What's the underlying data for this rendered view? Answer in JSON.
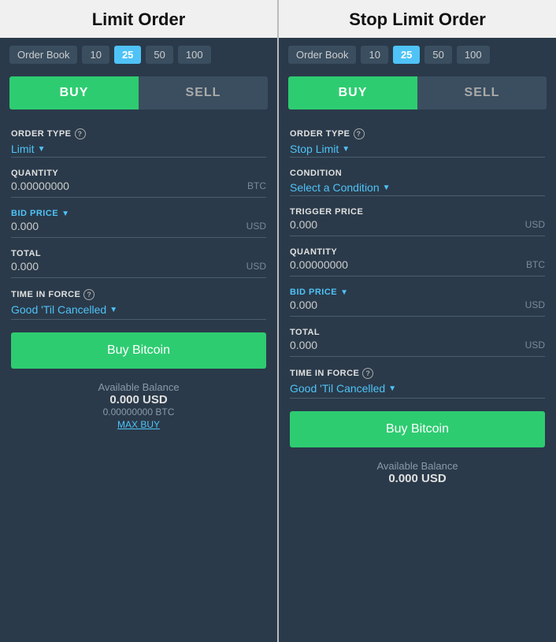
{
  "left_panel": {
    "title": "Limit Order",
    "order_book": {
      "label": "Order Book",
      "options": [
        "10",
        "25",
        "50",
        "100"
      ],
      "active": "25"
    },
    "buy_label": "BUY",
    "sell_label": "SELL",
    "order_type_label": "ORDER TYPE",
    "order_type_value": "Limit",
    "quantity_label": "QUANTITY",
    "quantity_value": "0.00000000",
    "quantity_unit": "BTC",
    "bid_price_label": "BID PRICE",
    "bid_price_value": "0.000",
    "bid_price_unit": "USD",
    "total_label": "TOTAL",
    "total_value": "0.000",
    "total_unit": "USD",
    "time_in_force_label": "TIME IN FORCE",
    "time_in_force_value": "Good 'Til Cancelled",
    "buy_button_label": "Buy Bitcoin",
    "available_balance_label": "Available Balance",
    "usd_amount": "0.000  USD",
    "btc_amount": "0.00000000 BTC",
    "max_buy_label": "MAX BUY"
  },
  "right_panel": {
    "title": "Stop Limit Order",
    "order_book": {
      "label": "Order Book",
      "options": [
        "10",
        "25",
        "50",
        "100"
      ],
      "active": "25"
    },
    "buy_label": "BUY",
    "sell_label": "SELL",
    "order_type_label": "ORDER TYPE",
    "order_type_value": "Stop Limit",
    "condition_label": "CONDITION",
    "condition_value": "Select a Condition",
    "trigger_price_label": "TRIGGER PRICE",
    "trigger_price_value": "0.000",
    "trigger_price_unit": "USD",
    "quantity_label": "QUANTITY",
    "quantity_value": "0.00000000",
    "quantity_unit": "BTC",
    "bid_price_label": "BID PRICE",
    "bid_price_value": "0.000",
    "bid_price_unit": "USD",
    "total_label": "TOTAL",
    "total_value": "0.000",
    "total_unit": "USD",
    "time_in_force_label": "TIME IN FORCE",
    "time_in_force_value": "Good 'Til Cancelled",
    "buy_button_label": "Buy Bitcoin",
    "available_balance_label": "Available Balance",
    "usd_amount": "0.000  USD"
  }
}
